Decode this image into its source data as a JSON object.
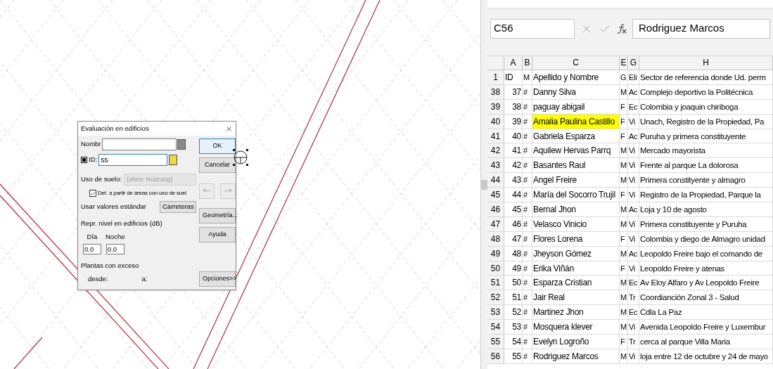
{
  "dialog": {
    "title": "Evaluación en edificios",
    "name_label": "Nombr",
    "id_checked": true,
    "id_label": "ID:",
    "id_value": "55",
    "land_use_label": "Uso de suelo:",
    "land_use_value": "(ohne Nutzung)",
    "land_use_disabled": true,
    "derive_checkbox": {
      "label": "Det. a partir de áreas con uso de suel",
      "checked": true
    },
    "defaults_label": "Usar valores estándar",
    "defaults_value": "Carreteras",
    "levels_label": "Repr. nivel en edificios (dB)",
    "day_label": "Día",
    "day_value": "0.0",
    "night_label": "Noche",
    "night_value": "0.0",
    "floors_label": "Plantas con exceso",
    "from_label": "desde:",
    "to_label": "a:",
    "buttons": [
      {
        "label": "OK",
        "kind": "default",
        "disabled": false
      },
      {
        "label": "Cancelar",
        "kind": "normal",
        "disabled": false
      },
      {
        "label": "<--",
        "kind": "nav",
        "disabled": true
      },
      {
        "label": "-->",
        "kind": "nav",
        "disabled": true
      },
      {
        "label": "Geometría...",
        "kind": "normal",
        "disabled": false
      },
      {
        "label": "Ayuda",
        "kind": "normal",
        "disabled": false
      },
      {
        "label": "Opciones>>",
        "kind": "bottom",
        "disabled": false
      }
    ]
  },
  "sheet": {
    "name_box": "C56",
    "formula": "Rodriguez Marcos",
    "columns": [
      "A",
      "B",
      "C",
      "E",
      "G",
      "H"
    ],
    "rows": [
      {
        "row": "1",
        "kind": "header",
        "highlight": false,
        "cells": [
          "ID",
          "M",
          "Apellido y Nombre",
          "G",
          "Eli",
          "Sector de referencia donde Ud. perm"
        ]
      },
      {
        "row": "38",
        "kind": "data",
        "highlight": false,
        "cells": [
          "37",
          "#",
          "Danny Silva",
          "M",
          "Ac",
          "Complejo deportivo la Politécnica"
        ]
      },
      {
        "row": "39",
        "kind": "data",
        "highlight": false,
        "cells": [
          "38",
          "#",
          "paguay abigail",
          "F",
          "Ec",
          "Colombia y joaquin chiriboga"
        ]
      },
      {
        "row": "40",
        "kind": "data",
        "highlight": true,
        "cells": [
          "39",
          "#",
          "Amalia Paulina Castillo",
          "F",
          "Vi",
          "Unach, Registro de la Propiedad, Pa"
        ]
      },
      {
        "row": "41",
        "kind": "data",
        "highlight": false,
        "cells": [
          "40",
          "#",
          "Gabriela Esparza",
          "F",
          "Ac",
          "Puruha y primera constituyente"
        ]
      },
      {
        "row": "42",
        "kind": "data",
        "highlight": false,
        "cells": [
          "41",
          "#",
          "Aquilew Hervas Parrq",
          "M",
          "Vi",
          "Mercado mayorista"
        ]
      },
      {
        "row": "43",
        "kind": "data",
        "highlight": false,
        "cells": [
          "42",
          "#",
          "Basantes Raul",
          "M",
          "Vi",
          "Frente al parque La dolorosa"
        ]
      },
      {
        "row": "44",
        "kind": "data",
        "highlight": false,
        "cells": [
          "43",
          "#",
          "Angel Freire",
          "M",
          "Vi",
          "Primera constityente y almagro"
        ]
      },
      {
        "row": "45",
        "kind": "data",
        "highlight": false,
        "cells": [
          "44",
          "#",
          "María del Socorro Trujil",
          "F",
          "Vi",
          "Registro de la Propiedad, Parque la"
        ]
      },
      {
        "row": "46",
        "kind": "data",
        "highlight": false,
        "cells": [
          "45",
          "#",
          "Bernal Jhon",
          "M",
          "Ac",
          "Loja y 10 de agosto"
        ]
      },
      {
        "row": "47",
        "kind": "data",
        "highlight": false,
        "cells": [
          "46",
          "#",
          "Velasco Vinicio",
          "M",
          "Vi",
          "Primera constituyente y Puruha"
        ]
      },
      {
        "row": "48",
        "kind": "data",
        "highlight": false,
        "cells": [
          "47",
          "#",
          "Flores Lorena",
          "F",
          "Vi",
          "Colombia y diego de Almagro unidad"
        ]
      },
      {
        "row": "49",
        "kind": "data",
        "highlight": false,
        "cells": [
          "48",
          "#",
          "Jheyson Gómez",
          "M",
          "Ac",
          "Leopoldo Freire bajo el comando de"
        ]
      },
      {
        "row": "50",
        "kind": "data",
        "highlight": false,
        "cells": [
          "49",
          "#",
          "Erika Viñán",
          "F",
          "Vi",
          "Leopoldo Freire y atenas"
        ]
      },
      {
        "row": "51",
        "kind": "data",
        "highlight": false,
        "cells": [
          "50",
          "#",
          "Esparza Cristian",
          "M",
          "Ec",
          "Av Eloy Alfaro y Av Leopoldo Freire"
        ]
      },
      {
        "row": "52",
        "kind": "data",
        "highlight": false,
        "cells": [
          "51",
          "#",
          "Jair Real",
          "M",
          "Tr",
          "Coordianción Zonal 3 - Salud"
        ]
      },
      {
        "row": "53",
        "kind": "data",
        "highlight": false,
        "cells": [
          "52",
          "#",
          "Martinez Jhon",
          "M",
          "Ec",
          "Cdla La Paz"
        ]
      },
      {
        "row": "54",
        "kind": "data",
        "highlight": false,
        "cells": [
          "53",
          "#",
          "Mosquera klever",
          "M",
          "Vi",
          "Avenida Leopoldo Freire y Luxembur"
        ]
      },
      {
        "row": "55",
        "kind": "data",
        "highlight": false,
        "cells": [
          "54",
          "#",
          "Evelyn Logroño",
          "F",
          "Tr",
          "cerca al parque Villa Maria"
        ]
      },
      {
        "row": "56",
        "kind": "data",
        "highlight": false,
        "cells": [
          "55",
          "#",
          "Rodriguez Marcos",
          "M",
          "Vi",
          "loja entre 12 de octubre y 24 de mayo"
        ]
      }
    ]
  }
}
